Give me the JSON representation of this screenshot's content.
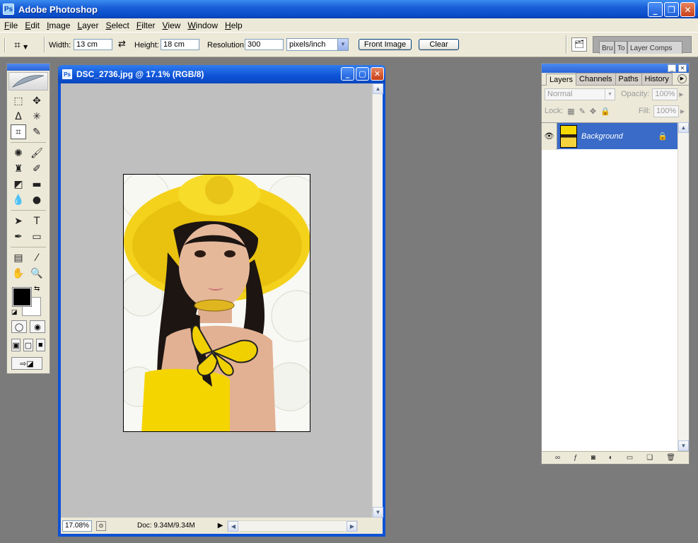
{
  "app": {
    "title": "Adobe Photoshop"
  },
  "window_controls": {
    "minimize": "_",
    "restore": "❐",
    "close": "✕"
  },
  "menu": [
    "File",
    "Edit",
    "Image",
    "Layer",
    "Select",
    "Filter",
    "View",
    "Window",
    "Help"
  ],
  "options": {
    "width_label": "Width:",
    "width_value": "13 cm",
    "height_label": "Height:",
    "height_value": "18 cm",
    "resolution_label": "Resolution:",
    "resolution_value": "300",
    "units_value": "pixels/inch",
    "front_image_label": "Front Image",
    "clear_label": "Clear",
    "well_tabs": [
      "Bru",
      "To",
      "Layer Comps"
    ]
  },
  "document": {
    "title": "DSC_2736.jpg @ 17.1% (RGB/8)",
    "zoom": "17.08%",
    "doc_info": "Doc: 9.34M/9.34M"
  },
  "layers_panel": {
    "tabs": [
      "Layers",
      "Channels",
      "Paths",
      "History"
    ],
    "active_tab": "Layers",
    "blend_mode": "Normal",
    "opacity_label": "Opacity:",
    "opacity_value": "100%",
    "lock_label": "Lock:",
    "fill_label": "Fill:",
    "fill_value": "100%",
    "layers": [
      {
        "name": "Background",
        "locked": true,
        "visible": true
      }
    ]
  },
  "colors": {
    "foreground": "#000000",
    "background": "#ffffff",
    "xp_blue": "#0d52d6",
    "selection": "#3a6bc8"
  }
}
